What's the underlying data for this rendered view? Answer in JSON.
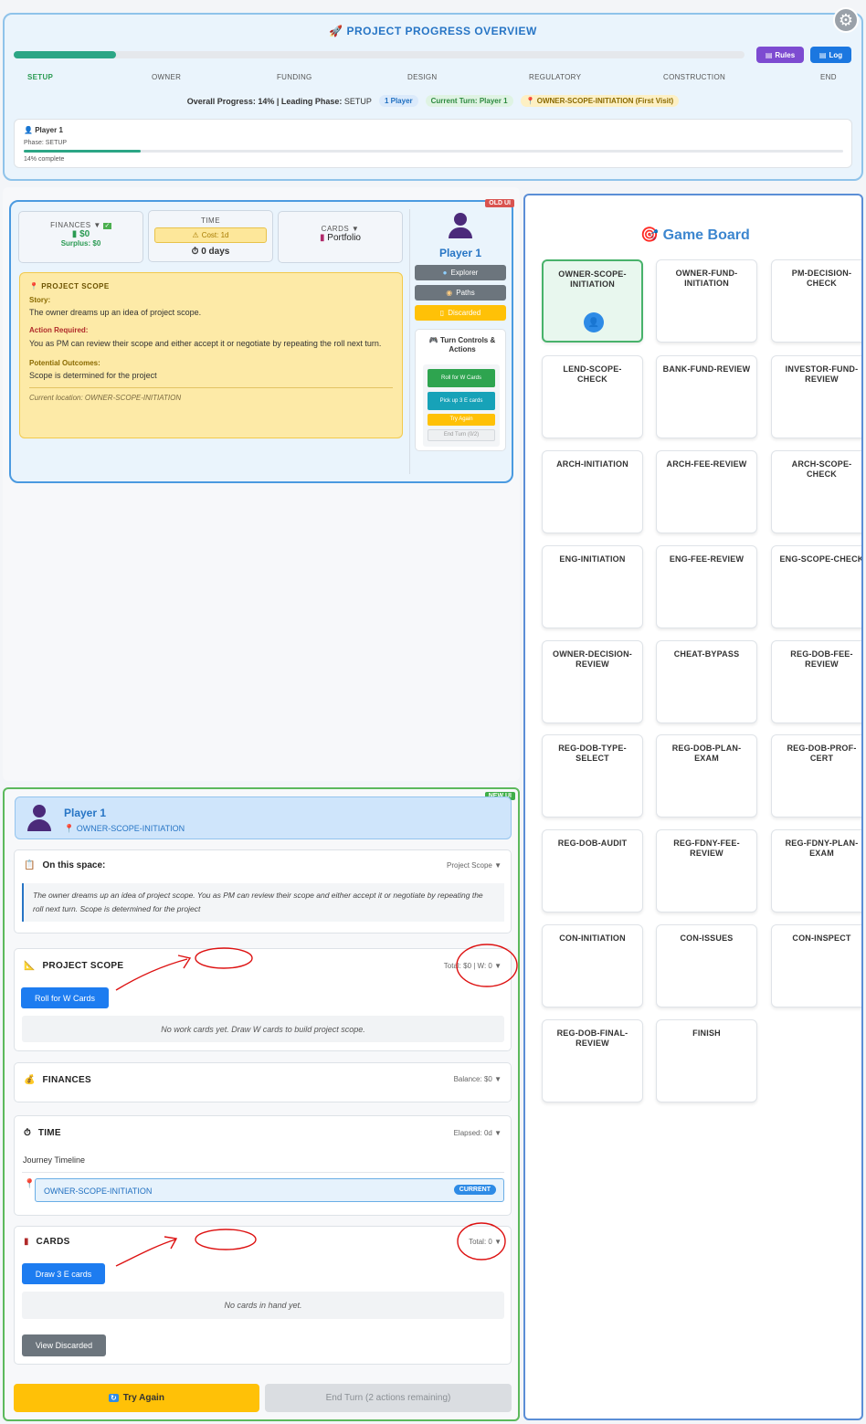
{
  "header": {
    "title": "PROJECT PROGRESS OVERVIEW",
    "rules_label": "Rules",
    "log_label": "Log",
    "progress_fraction": 0.14,
    "phases": [
      "SETUP",
      "OWNER",
      "FUNDING",
      "DESIGN",
      "REGULATORY",
      "CONSTRUCTION",
      "END"
    ],
    "overall_label": "Overall Progress:",
    "overall_value": "14% | Leading Phase:",
    "leading_phase": "SETUP",
    "players_pill": "1 Player",
    "turn_pill": "Current Turn: Player 1",
    "location_pill": "OWNER-SCOPE-INITIATION (First Visit)",
    "player_card": {
      "name": "Player 1",
      "phase": "Phase: SETUP",
      "complete": "14% complete"
    }
  },
  "old_ui": {
    "badge": "OLD UI",
    "finances_label": "FINANCES ▼",
    "finances_value": "$0",
    "finances_surplus": "Surplus: $0",
    "time_label": "TIME",
    "time_cost": "Cost: 1d",
    "time_value": "0 days",
    "cards_label": "CARDS ▼",
    "cards_value": "Portfolio",
    "scope_title": "PROJECT SCOPE",
    "story_label": "Story:",
    "story_text": "The owner dreams up an idea of project scope.",
    "action_label": "Action Required:",
    "action_text": "You as PM can review their scope and either accept it or negotiate by repeating the roll next turn.",
    "outcomes_label": "Potential Outcomes:",
    "outcomes_text": "Scope is determined for the project",
    "location_text": "Current location: OWNER-SCOPE-INITIATION",
    "player_name": "Player 1",
    "explorer_btn": "Explorer",
    "paths_btn": "Paths",
    "discarded_btn": "Discarded",
    "turn_controls_title": "Turn Controls & Actions",
    "roll_w_btn": "Roll for W Cards",
    "pick_e_btn": "Pick up 3 E cards",
    "try_again_btn": "Try Again",
    "end_turn_btn": "End Turn (0/2)"
  },
  "new_ui": {
    "badge": "NEW UI",
    "player_name": "Player 1",
    "location": "OWNER-SCOPE-INITIATION",
    "space_title": "On this space:",
    "space_right": "Project Scope",
    "space_text": "The owner dreams up an idea of project scope. You as PM can review their scope and either accept it or negotiate by repeating the roll next turn. Scope is determined for the project",
    "scope_title": "PROJECT SCOPE",
    "scope_right": "Total: $0 | W: 0",
    "roll_w_btn": "Roll for W Cards",
    "scope_empty": "No work cards yet. Draw W cards to build project scope.",
    "finances_title": "FINANCES",
    "finances_right": "Balance: $0",
    "time_title": "TIME",
    "time_right": "Elapsed: 0d",
    "timeline_label": "Journey Timeline",
    "timeline_space": "OWNER-SCOPE-INITIATION",
    "timeline_badge": "CURRENT",
    "cards_title": "CARDS",
    "cards_right": "Total: 0",
    "draw_e_btn": "Draw 3 E cards",
    "cards_empty": "No cards in hand yet.",
    "view_discarded_btn": "View Discarded",
    "try_again_btn": "Try Again",
    "end_turn_btn": "End Turn (2 actions remaining)"
  },
  "board": {
    "title": "Game Board",
    "spaces": [
      "OWNER-SCOPE-INITIATION",
      "OWNER-FUND-INITIATION",
      "PM-DECISION-CHECK",
      "LEND-SCOPE-CHECK",
      "BANK-FUND-REVIEW",
      "INVESTOR-FUND-REVIEW",
      "ARCH-INITIATION",
      "ARCH-FEE-REVIEW",
      "ARCH-SCOPE-CHECK",
      "ENG-INITIATION",
      "ENG-FEE-REVIEW",
      "ENG-SCOPE-CHECK",
      "OWNER-DECISION-REVIEW",
      "CHEAT-BYPASS",
      "REG-DOB-FEE-REVIEW",
      "REG-DOB-TYPE-SELECT",
      "REG-DOB-PLAN-EXAM",
      "REG-DOB-PROF-CERT",
      "REG-DOB-AUDIT",
      "REG-FDNY-FEE-REVIEW",
      "REG-FDNY-PLAN-EXAM",
      "CON-INITIATION",
      "CON-ISSUES",
      "CON-INSPECT",
      "REG-DOB-FINAL-REVIEW",
      "FINISH"
    ],
    "active_space": "OWNER-SCOPE-INITIATION"
  },
  "colors": {
    "accent": "#2775c5",
    "progress": "#2ca685",
    "old_ui_badge": "#d9534f",
    "new_ui_badge": "#3fae49",
    "warning": "#ffc107"
  }
}
